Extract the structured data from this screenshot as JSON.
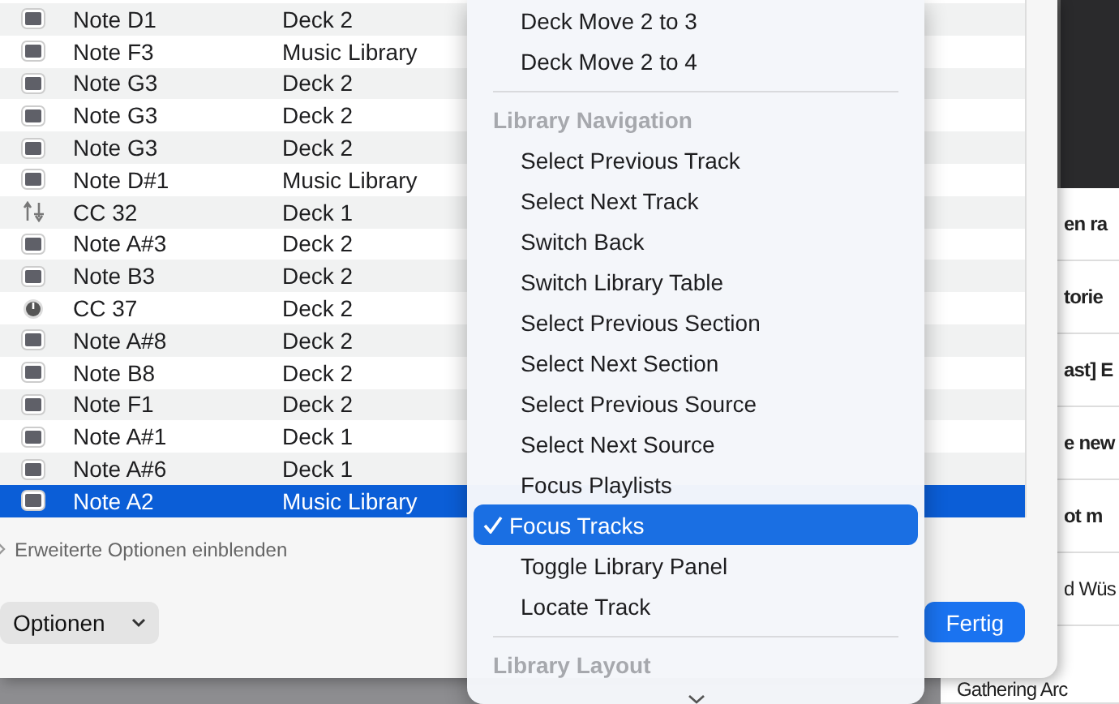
{
  "mappings": [
    {
      "kind": "note",
      "name": "Note D1",
      "target": "Deck 2",
      "selected": false
    },
    {
      "kind": "note",
      "name": "Note F3",
      "target": "Music Library",
      "selected": false
    },
    {
      "kind": "note",
      "name": "Note G3",
      "target": "Deck 2",
      "selected": false
    },
    {
      "kind": "note",
      "name": "Note G3",
      "target": "Deck 2",
      "selected": false
    },
    {
      "kind": "note",
      "name": "Note G3",
      "target": "Deck 2",
      "selected": false
    },
    {
      "kind": "note",
      "name": "Note D#1",
      "target": "Music Library",
      "selected": false
    },
    {
      "kind": "fader",
      "name": "CC 32",
      "target": "Deck 1",
      "selected": false
    },
    {
      "kind": "note",
      "name": "Note A#3",
      "target": "Deck 2",
      "selected": false
    },
    {
      "kind": "note",
      "name": "Note B3",
      "target": "Deck 2",
      "selected": false
    },
    {
      "kind": "knob",
      "name": "CC 37",
      "target": "Deck 2",
      "selected": false
    },
    {
      "kind": "note",
      "name": "Note A#8",
      "target": "Deck 2",
      "selected": false
    },
    {
      "kind": "note",
      "name": "Note B8",
      "target": "Deck 2",
      "selected": false
    },
    {
      "kind": "note",
      "name": "Note F1",
      "target": "Deck 2",
      "selected": false
    },
    {
      "kind": "note",
      "name": "Note A#1",
      "target": "Deck 1",
      "selected": false
    },
    {
      "kind": "note",
      "name": "Note A#6",
      "target": "Deck 1",
      "selected": false
    },
    {
      "kind": "note",
      "name": "Note A2",
      "target": "Music Library",
      "selected": true
    }
  ],
  "advanced_toggle": "Erweiterte Optionen einblenden",
  "options_button": "Optionen",
  "done_button": "Fertig",
  "menu": [
    {
      "kind": "item",
      "label": "Deck Move 2 to 3",
      "checked": false
    },
    {
      "kind": "item",
      "label": "Deck Move 2 to 4",
      "checked": false
    },
    {
      "kind": "separator"
    },
    {
      "kind": "header",
      "label": "Library Navigation"
    },
    {
      "kind": "item",
      "label": "Select Previous Track",
      "checked": false
    },
    {
      "kind": "item",
      "label": "Select Next Track",
      "checked": false
    },
    {
      "kind": "item",
      "label": "Switch Back",
      "checked": false
    },
    {
      "kind": "item",
      "label": "Switch Library Table",
      "checked": false
    },
    {
      "kind": "item",
      "label": "Select Previous Section",
      "checked": false
    },
    {
      "kind": "item",
      "label": "Select Next Section",
      "checked": false
    },
    {
      "kind": "item",
      "label": "Select Previous Source",
      "checked": false
    },
    {
      "kind": "item",
      "label": "Select Next Source",
      "checked": false
    },
    {
      "kind": "item",
      "label": "Focus Playlists",
      "checked": false
    },
    {
      "kind": "item",
      "label": "Focus Tracks",
      "checked": true
    },
    {
      "kind": "item",
      "label": "Toggle Library Panel",
      "checked": false
    },
    {
      "kind": "item",
      "label": "Locate Track",
      "checked": false
    },
    {
      "kind": "separator"
    },
    {
      "kind": "header",
      "label": "Library Layout"
    }
  ],
  "background_list": [
    {
      "text": "en ra",
      "kind": "bold"
    },
    {
      "text": "torie",
      "kind": "bold"
    },
    {
      "text": "ast] E",
      "kind": "bold"
    },
    {
      "text": "e new",
      "kind": "bold"
    },
    {
      "text": "ot m",
      "kind": "bold"
    },
    {
      "text": "d Wüs",
      "kind": "plain"
    },
    {
      "text": "Gathering Arc",
      "kind": "plain"
    }
  ]
}
